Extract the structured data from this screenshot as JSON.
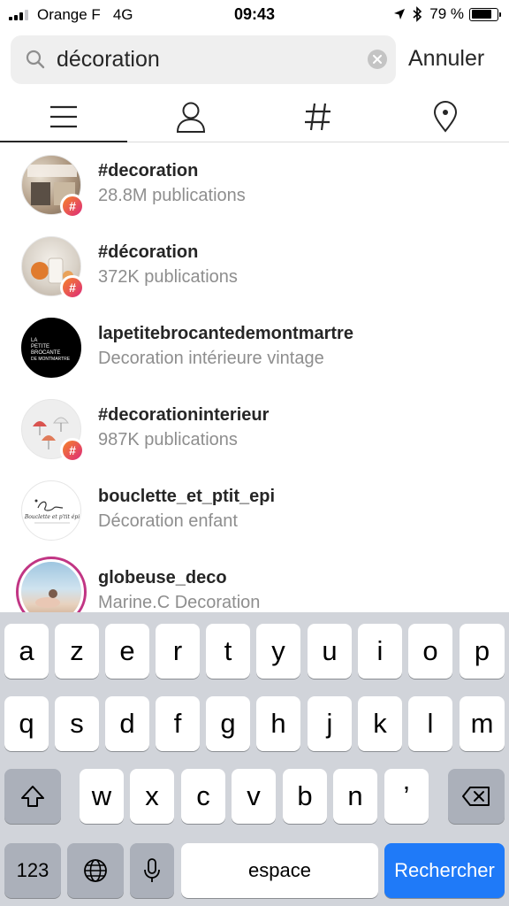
{
  "status_bar": {
    "carrier": "Orange F",
    "network": "4G",
    "time": "09:43",
    "battery": "79 %",
    "battery_level": 0.79
  },
  "search": {
    "query": "décoration",
    "cancel_label": "Annuler"
  },
  "tabs": [
    {
      "icon": "list-icon",
      "active": true
    },
    {
      "icon": "person-icon",
      "active": false
    },
    {
      "icon": "hashtag-icon",
      "active": false
    },
    {
      "icon": "location-pin-icon",
      "active": false
    }
  ],
  "results": [
    {
      "title": "#decoration",
      "subtitle": "28.8M publications",
      "type": "hashtag"
    },
    {
      "title": "#décoration",
      "subtitle": "372K publications",
      "type": "hashtag"
    },
    {
      "title": "lapetitebrocantedemontmartre",
      "subtitle": "Decoration intérieure vintage",
      "type": "account",
      "avatar_text": "LA PETITE BROCANTE DE MONTMARTRE"
    },
    {
      "title": "#decorationinterieur",
      "subtitle": "987K publications",
      "type": "hashtag"
    },
    {
      "title": "bouclette_et_ptit_epi",
      "subtitle": "Décoration enfant",
      "type": "account",
      "avatar_text": "Bouclette et p'tit épi"
    },
    {
      "title": "globeuse_deco",
      "subtitle": "Marine.C Decoration",
      "type": "account"
    }
  ],
  "keyboard": {
    "row1": [
      "a",
      "z",
      "e",
      "r",
      "t",
      "y",
      "u",
      "i",
      "o",
      "p"
    ],
    "row2": [
      "q",
      "s",
      "d",
      "f",
      "g",
      "h",
      "j",
      "k",
      "l",
      "m"
    ],
    "row3": [
      "w",
      "x",
      "c",
      "v",
      "b",
      "n",
      "’"
    ],
    "numbers_key": "123",
    "space_key": "espace",
    "return_key": "Rechercher"
  },
  "colors": {
    "accent_blue": "#1f7af8",
    "hashtag_badge": "#dd2a7b",
    "story_ring": "#c13584"
  }
}
